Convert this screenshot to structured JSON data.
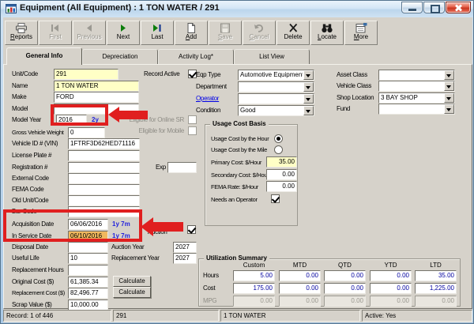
{
  "window": {
    "title": "Equipment (All Equipment) : 1 TON WATER / 291"
  },
  "toolbar": {
    "buttons": [
      {
        "label": "Reports"
      },
      {
        "label": "First"
      },
      {
        "label": "Previous"
      },
      {
        "label": "Next"
      },
      {
        "label": "Last"
      },
      {
        "label": "Add"
      },
      {
        "label": "Save"
      },
      {
        "label": "Cancel"
      },
      {
        "label": "Delete"
      },
      {
        "label": "Locate"
      },
      {
        "label": "More"
      }
    ]
  },
  "tabs": [
    {
      "label": "General Info"
    },
    {
      "label": "Depreciation"
    },
    {
      "label": "Activity Log*"
    },
    {
      "label": "List View"
    }
  ],
  "fields": {
    "unit_code_label": "Unit/Code",
    "unit_code": "291",
    "record_active_label": "Record Active",
    "name_label": "Name",
    "name": "1 TON WATER",
    "make_label": "Make",
    "make": "FORD",
    "model_label": "Model",
    "model": "",
    "model_year_label": "Model Year",
    "model_year": "2016",
    "model_year_age": "2y",
    "eligible_sr_label": "Eligible for Online SR",
    "eligible_mobile_label": "Eligible for Mobile",
    "gvw_label": "Gross Vehicle Weight",
    "gvw": "0",
    "vin_label": "Vehicle ID # (VIN)",
    "vin": "1FTRF3D62HED71116",
    "license_label": "License Plate #",
    "license": "",
    "registration_label": "Registration #",
    "registration": "",
    "exp_label": "Exp",
    "exp": "",
    "external_label": "External Code",
    "external": "",
    "fema_label": "FEMA Code",
    "fema": "",
    "old_unit_label": "Old Unit/Code",
    "old_unit": "",
    "bar_code_label": "Bar Code",
    "bar_code": "",
    "acquisition_label": "Acquisition Date",
    "acquisition": "06/06/2016",
    "acquisition_age": "1y 7m",
    "in_service_label": "In Service Date",
    "in_service": "06/10/2016",
    "in_service_age": "1y 7m",
    "disposal_label": "Disposal Date",
    "disposal": "",
    "flagged_label": "Flagged for Auction",
    "auction_year_label": "Auction Year",
    "auction_year": "2027",
    "useful_life_label": "Useful Life",
    "useful_life": "10",
    "replacement_year_label": "Replacement Year",
    "replacement_year": "2027",
    "replacement_hours_label": "Replacement Hours",
    "replacement_hours": "",
    "original_cost_label": "Original Cost ($)",
    "original_cost": "61,385.34",
    "replacement_cost_label": "Replacement Cost ($)",
    "replacement_cost": "82,496.77",
    "scrap_value_label": "Scrap Value ($)",
    "scrap_value": "10,000.00",
    "calculate_label": "Calculate"
  },
  "middle": {
    "eqp_type_label": "Eqp Type",
    "eqp_type": "Automotive Equipment",
    "department_label": "Department",
    "department": "",
    "operator_label": "Operator",
    "operator": "",
    "condition_label": "Condition",
    "condition": "Good",
    "usage_title": "Usage Cost Basis",
    "by_hour_label": "Usage Cost by the Hour",
    "by_mile_label": "Usage Cost by the Mile",
    "primary_label": "Primary Cost: $/Hour",
    "primary": "35.00",
    "secondary_label": "Secondary Cost: $/Hour",
    "secondary": "0.00",
    "fema_rate_label": "FEMA Rate: $/Hour",
    "fema_rate": "0.00",
    "needs_operator_label": "Needs an Operator"
  },
  "right": {
    "asset_class_label": "Asset Class",
    "asset_class": "",
    "vehicle_class_label": "Vehicle Class",
    "vehicle_class": "",
    "shop_location_label": "Shop Location",
    "shop_location": "3 BAY SHOP",
    "fund_label": "Fund",
    "fund": ""
  },
  "utilization": {
    "title": "Utilization Summary",
    "columns": [
      "Custom",
      "MTD",
      "QTD",
      "YTD",
      "LTD"
    ],
    "rows": [
      {
        "label": "Hours",
        "values": [
          "5.00",
          "0.00",
          "0.00",
          "0.00",
          "35.00"
        ]
      },
      {
        "label": "Cost",
        "values": [
          "175.00",
          "0.00",
          "0.00",
          "0.00",
          "1,225.00"
        ]
      },
      {
        "label": "MPG",
        "values": [
          "0.00",
          "0.00",
          "0.00",
          "0.00",
          "0.00"
        ]
      }
    ]
  },
  "statusbar": {
    "record": "Record: 1 of 446",
    "unit": "291",
    "name": "1 TON WATER",
    "active": "Active: Yes"
  },
  "colors": {
    "required_field_bg": "#ffffc6",
    "highlight_field_bg": "#f0b85e",
    "annotation_red": "#e01f1f",
    "age_text_blue": "#2222dd",
    "value_text_blue": "#00009f"
  }
}
